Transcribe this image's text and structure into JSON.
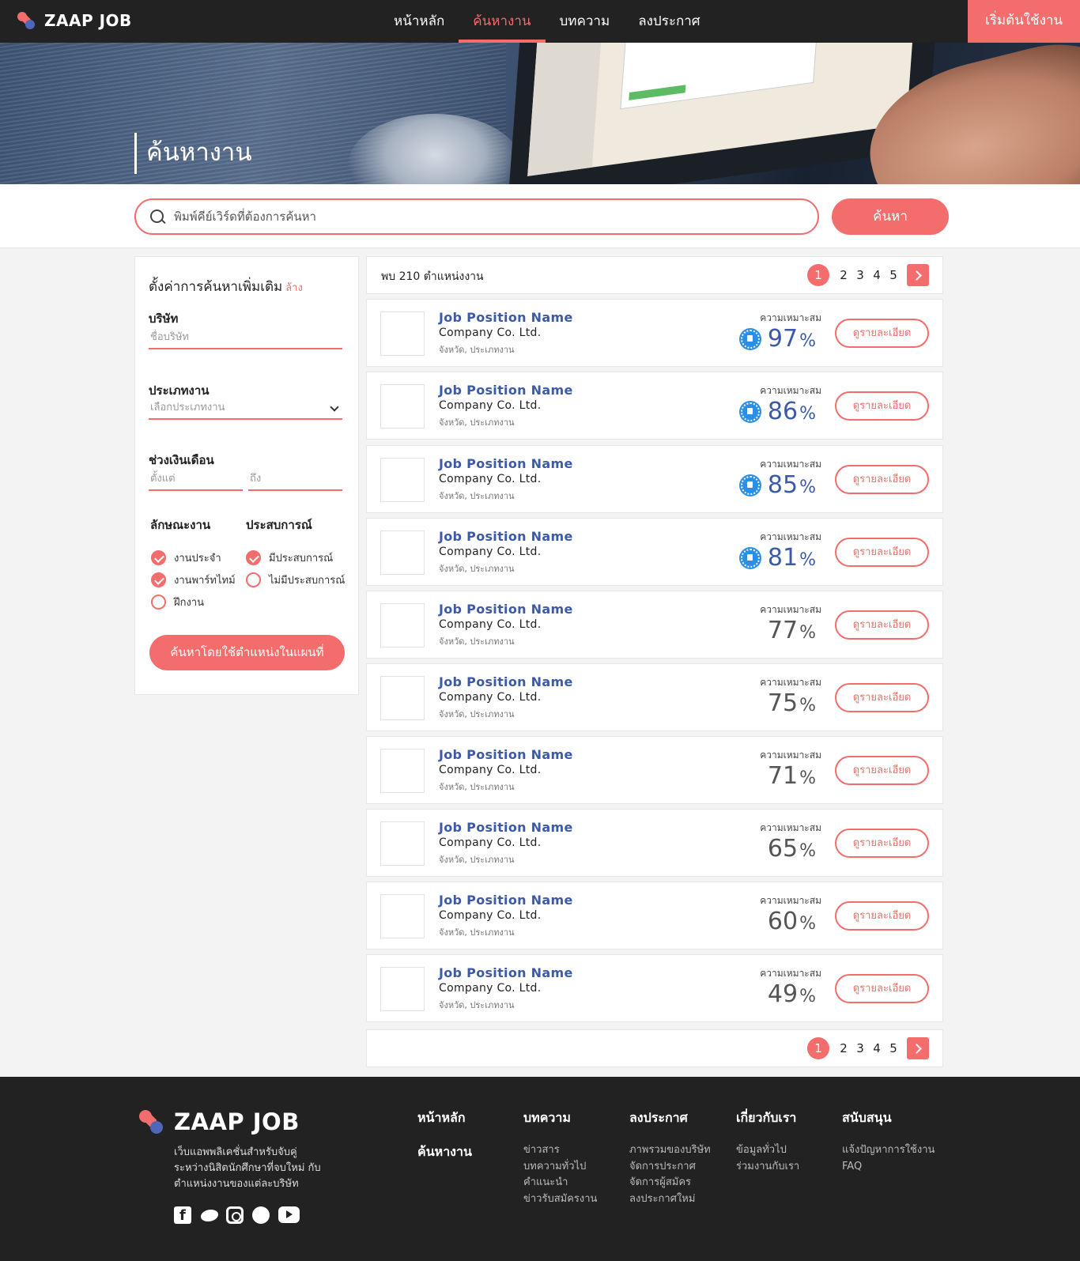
{
  "brand": {
    "name": "ZAAP JOB"
  },
  "nav": {
    "items": [
      {
        "label": "หน้าหลัก",
        "active": false
      },
      {
        "label": "ค้นหางาน",
        "active": true
      },
      {
        "label": "บทความ",
        "active": false
      },
      {
        "label": "ลงประกาศ",
        "active": false
      }
    ],
    "cta": "เริ่มต้นใช้งาน"
  },
  "hero": {
    "title": "ค้นหางาน"
  },
  "search": {
    "placeholder": "พิมพ์คีย์เวิร์ดที่ต้องการค้นหา",
    "value": "",
    "button": "ค้นหา"
  },
  "filters": {
    "title": "ตั้งค่าการค้นหาเพิ่มเติม",
    "clear": "ล้าง",
    "company": {
      "label": "บริษัท",
      "placeholder": "ชื่อบริษัท"
    },
    "job_type": {
      "label": "ประเภทงาน",
      "placeholder": "เลือกประเภทงาน"
    },
    "salary": {
      "label": "ช่วงเงินเดือน",
      "from_placeholder": "ตั้งแต่",
      "to_placeholder": "ถึง"
    },
    "nature": {
      "label": "ลักษณะงาน",
      "options": [
        {
          "label": "งานประจำ",
          "checked": true
        },
        {
          "label": "งานพาร์ทไทม์",
          "checked": true
        },
        {
          "label": "ฝึกงาน",
          "checked": false
        }
      ]
    },
    "experience": {
      "label": "ประสบการณ์",
      "options": [
        {
          "label": "มีประสบการณ์",
          "checked": true
        },
        {
          "label": "ไม่มีประสบการณ์",
          "checked": false
        }
      ]
    },
    "map_button": "ค้นหาโดยใช้ตำแหน่งในแผนที่"
  },
  "results": {
    "count_text": "พบ 210 ตำแหน่งงาน",
    "pages": [
      "1",
      "2",
      "3",
      "4",
      "5"
    ],
    "current_page": "1",
    "match_label": "ความเหมาะสม",
    "detail_label": "ดูรายละเอียด",
    "percent_sign": "%",
    "jobs": [
      {
        "title": "Job Position Name",
        "company": "Company Co. Ltd.",
        "location": "จังหวัด, ประเภทงาน",
        "match": "97",
        "top": true
      },
      {
        "title": "Job Position Name",
        "company": "Company Co. Ltd.",
        "location": "จังหวัด, ประเภทงาน",
        "match": "86",
        "top": true
      },
      {
        "title": "Job Position Name",
        "company": "Company Co. Ltd.",
        "location": "จังหวัด, ประเภทงาน",
        "match": "85",
        "top": true
      },
      {
        "title": "Job Position Name",
        "company": "Company Co. Ltd.",
        "location": "จังหวัด, ประเภทงาน",
        "match": "81",
        "top": true
      },
      {
        "title": "Job Position Name",
        "company": "Company Co. Ltd.",
        "location": "จังหวัด, ประเภทงาน",
        "match": "77",
        "top": false
      },
      {
        "title": "Job Position Name",
        "company": "Company Co. Ltd.",
        "location": "จังหวัด, ประเภทงาน",
        "match": "75",
        "top": false
      },
      {
        "title": "Job Position Name",
        "company": "Company Co. Ltd.",
        "location": "จังหวัด, ประเภทงาน",
        "match": "71",
        "top": false
      },
      {
        "title": "Job Position Name",
        "company": "Company Co. Ltd.",
        "location": "จังหวัด, ประเภทงาน",
        "match": "65",
        "top": false
      },
      {
        "title": "Job Position Name",
        "company": "Company Co. Ltd.",
        "location": "จังหวัด, ประเภทงาน",
        "match": "60",
        "top": false
      },
      {
        "title": "Job Position Name",
        "company": "Company Co. Ltd.",
        "location": "จังหวัด, ประเภทงาน",
        "match": "49",
        "top": false
      }
    ]
  },
  "footer": {
    "brand": "ZAAP JOB",
    "tagline": "เว็บแอพพลิเคชั่นสำหรับจับคู่ ระหว่างนิสิตนักศึกษาที่จบใหม่ กับตำแหน่งงานของแต่ละบริษัท",
    "social": [
      "facebook-icon",
      "twitter-icon",
      "instagram-icon",
      "line-icon",
      "youtube-icon"
    ],
    "col_home": [
      "หน้าหลัก",
      "ค้นหางาน"
    ],
    "columns": [
      {
        "title": "บทความ",
        "links": [
          "ข่าวสาร",
          "บทความทั่วไป",
          "คำแนะนำ",
          "ข่าวรับสมัครงาน"
        ]
      },
      {
        "title": "ลงประกาศ",
        "links": [
          "ภาพรวมของบริษัท",
          "จัดการประกาศ",
          "จัดการผู้สมัคร",
          "ลงประกาศใหม่"
        ]
      },
      {
        "title": "เกี่ยวกับเรา",
        "links": [
          "ข้อมูลทั่วไป",
          "ร่วมงานกับเรา"
        ]
      },
      {
        "title": "สนับสนุน",
        "links": [
          "แจ้งปัญหาการใช้งาน",
          "FAQ"
        ]
      }
    ]
  },
  "colors": {
    "accent": "#f26d6b",
    "brand_blue": "#3d5aa8",
    "dark": "#222222",
    "badge_blue": "#2b8fe6"
  }
}
